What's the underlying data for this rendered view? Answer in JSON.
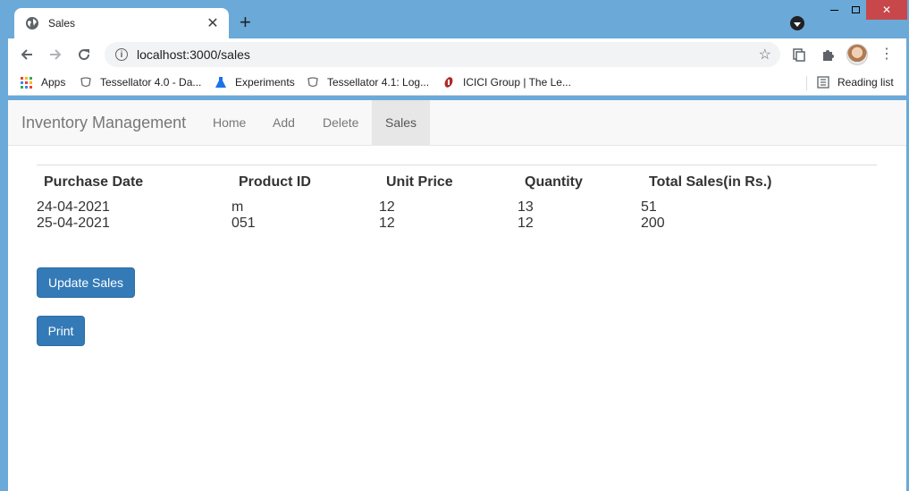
{
  "browser": {
    "tab_title": "Sales",
    "url": "localhost:3000/sales",
    "bookmarks": [
      {
        "label": "Apps"
      },
      {
        "label": "Tessellator 4.0 - Da..."
      },
      {
        "label": "Experiments"
      },
      {
        "label": "Tessellator 4.1: Log..."
      },
      {
        "label": "ICICI Group | The Le..."
      }
    ],
    "reading_list": "Reading list"
  },
  "navbar": {
    "brand": "Inventory Management",
    "links": [
      {
        "label": "Home"
      },
      {
        "label": "Add"
      },
      {
        "label": "Delete"
      },
      {
        "label": "Sales"
      }
    ]
  },
  "table": {
    "headers": [
      "Purchase Date",
      "Product ID",
      "Unit Price",
      "Quantity",
      "Total Sales(in Rs.)"
    ],
    "rows": [
      [
        "24-04-2021",
        "m",
        "12",
        "13",
        "51"
      ],
      [
        "25-04-2021",
        "051",
        "12",
        "12",
        "200"
      ]
    ]
  },
  "buttons": {
    "update_sales": "Update Sales",
    "print": "Print"
  },
  "colors": {
    "primary_button": "#337ab7",
    "window_frame": "#6aa9d8",
    "close_button": "#c8474b"
  }
}
